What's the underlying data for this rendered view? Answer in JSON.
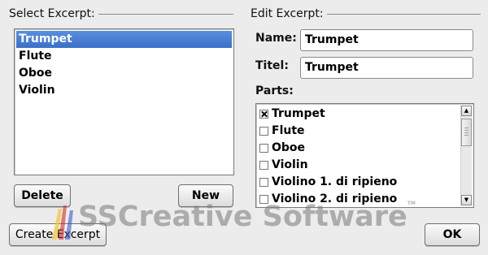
{
  "select_group": {
    "title": "Select Excerpt:"
  },
  "edit_group": {
    "title": "Edit Excerpt:"
  },
  "excerpts": {
    "items": [
      {
        "label": "Trumpet",
        "selected": true
      },
      {
        "label": "Flute",
        "selected": false
      },
      {
        "label": "Oboe",
        "selected": false
      },
      {
        "label": "Violin",
        "selected": false
      }
    ]
  },
  "buttons": {
    "delete": "Delete",
    "new": "New",
    "create": "Create Excerpt",
    "ok": "OK"
  },
  "form": {
    "name_label": "Name:",
    "name_value": "Trumpet",
    "titel_label": "Titel:",
    "titel_value": "Trumpet",
    "parts_label": "Parts:"
  },
  "parts": [
    {
      "label": "Trumpet",
      "checked": true
    },
    {
      "label": "Flute",
      "checked": false
    },
    {
      "label": "Oboe",
      "checked": false
    },
    {
      "label": "Violin",
      "checked": false
    },
    {
      "label": "Violino 1.  di ripieno",
      "checked": false
    },
    {
      "label": "Violino 2.  di ripieno",
      "checked": false
    }
  ],
  "watermark": {
    "text": "SSCreative Software",
    "trademark": "TM"
  },
  "colors": {
    "selection": "#3a6fc8",
    "background": "#ececec"
  }
}
